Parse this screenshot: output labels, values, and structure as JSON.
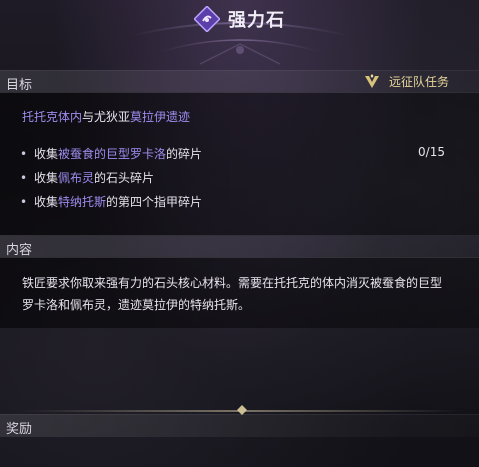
{
  "window": {
    "title": "强力石",
    "title_icon": "quest-scroll-icon"
  },
  "objective": {
    "header": "目标",
    "quest_type": "远征队任务",
    "quest_type_icon": "expedition-crest-icon",
    "title_parts": {
      "a": "托托克体内",
      "b": "与尤狄亚",
      "c": "莫拉伊遗迹"
    },
    "tasks": [
      {
        "pre": "收集",
        "highlight": "被蚕食的巨型罗卡洛",
        "post": "的碎片",
        "progress": "0/15"
      },
      {
        "pre": "收集",
        "highlight": "佩布灵",
        "post": "的石头碎片",
        "progress": ""
      },
      {
        "pre": "收集",
        "highlight": "特纳托斯",
        "post": "的第四个指甲碎片",
        "progress": ""
      }
    ]
  },
  "content": {
    "header": "内容",
    "text": "铁匠要求你取来强有力的石头核心材料。需要在托托克的体内消灭被蚕食的巨型罗卡洛和佩布灵，遗迹莫拉伊的特纳托斯。"
  },
  "reward": {
    "header": "奖励"
  },
  "colors": {
    "accent": "#9f8df0",
    "quest_type": "#e7d59c",
    "background": "#14121a"
  }
}
